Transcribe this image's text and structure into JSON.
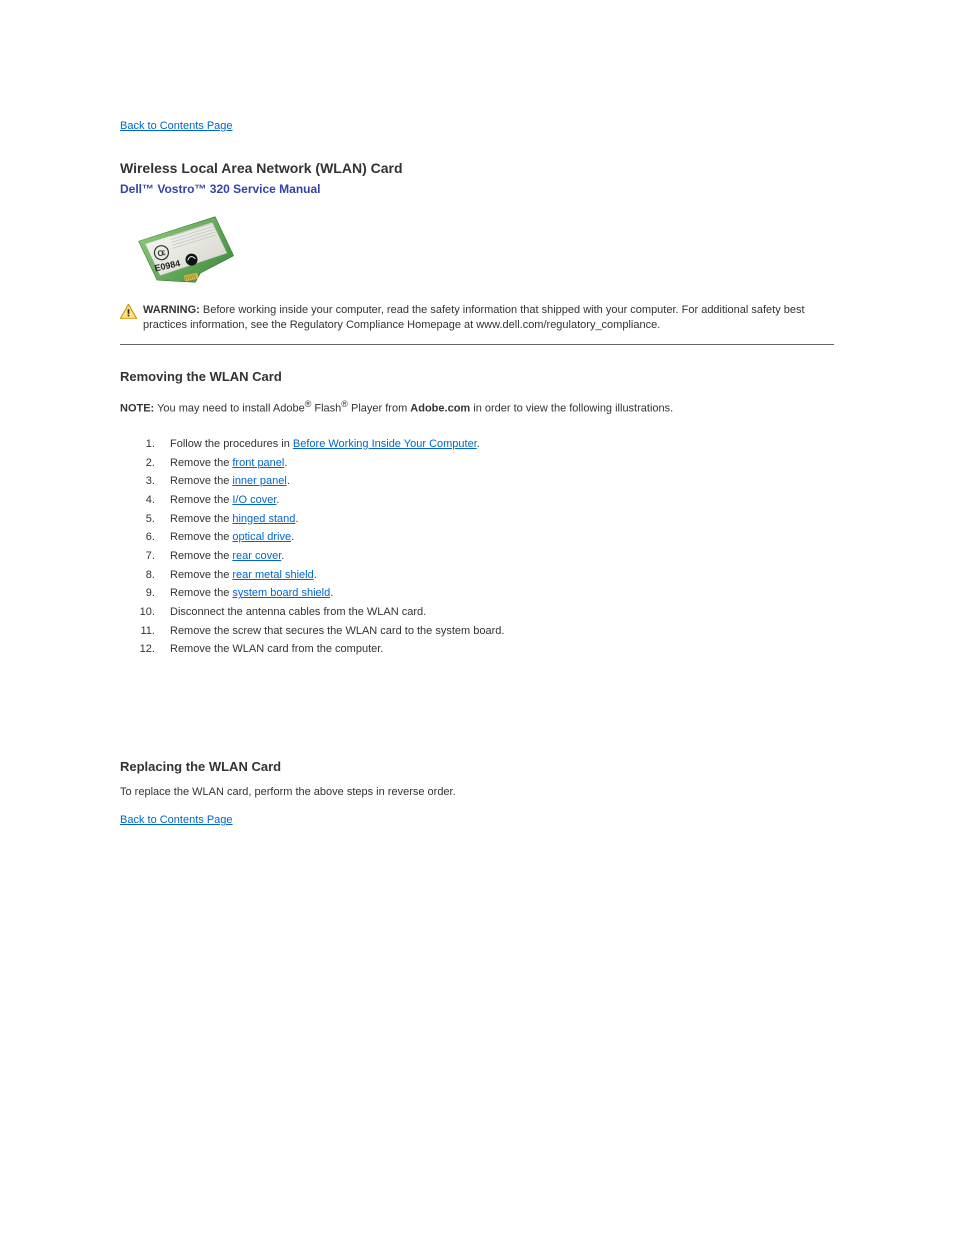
{
  "nav": {
    "back_link_top": "Back to Contents Page",
    "back_link_bottom": "Back to Contents Page"
  },
  "header": {
    "title": "Wireless Local Area Network (WLAN) Card",
    "subtitle": "Dell™ Vostro™ 320 Service Manual"
  },
  "warning": {
    "label": "WARNING:",
    "text": "Before working inside your computer, read the safety information that shipped with your computer. For additional safety best practices information, see the Regulatory Compliance Homepage at www.dell.com/regulatory_compliance."
  },
  "section_remove": {
    "heading": "Removing the WLAN Card",
    "note_label": "NOTE:",
    "note_text": "You may need to install Adobe",
    "note_text2": " Flash",
    "note_text3": " Player from ",
    "note_bold_site": "Adobe.com",
    "note_text4": " in order to view the following illustrations.",
    "steps": [
      {
        "prefix": "Follow the procedures in ",
        "link": "Before Working Inside Your Computer",
        "suffix": "."
      },
      {
        "prefix": "Remove the ",
        "link": "front panel",
        "suffix": "."
      },
      {
        "prefix": "Remove the ",
        "link": "inner panel",
        "suffix": "."
      },
      {
        "prefix": "Remove the ",
        "link": "I/O cover",
        "suffix": "."
      },
      {
        "prefix": "Remove the ",
        "link": "hinged stand",
        "suffix": "."
      },
      {
        "prefix": "Remove the ",
        "link": "optical drive",
        "suffix": "."
      },
      {
        "prefix": "Remove the ",
        "link": "rear cover",
        "suffix": "."
      },
      {
        "prefix": "Remove the ",
        "link": "rear metal shield",
        "suffix": "."
      },
      {
        "prefix": "Remove the ",
        "link": "system board shield",
        "suffix": "."
      },
      {
        "plain": "Disconnect the antenna cables from the WLAN card."
      },
      {
        "plain": "Remove the screw that secures the WLAN card to the system board."
      },
      {
        "plain": "Remove the WLAN card from the computer."
      }
    ]
  },
  "section_replace": {
    "heading": "Replacing the WLAN Card",
    "text": "To replace the WLAN card, perform the above steps in reverse order."
  }
}
